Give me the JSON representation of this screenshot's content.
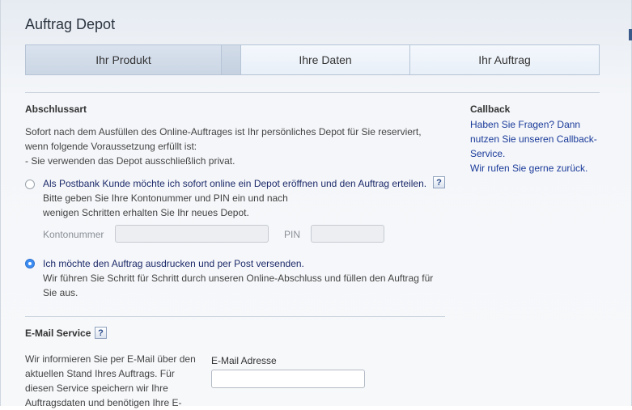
{
  "header": {
    "title": "Auftrag Depot"
  },
  "tabs": [
    {
      "label": "Ihr Produkt"
    },
    {
      "label": "Ihre Daten"
    },
    {
      "label": "Ihr Auftrag"
    }
  ],
  "abschluss": {
    "heading": "Abschlussart",
    "intro_line1": "Sofort nach dem Ausfüllen des Online-Auftrages ist Ihr persönliches Depot für Sie reserviert,",
    "intro_line2": "wenn folgende Voraussetzung erfüllt ist:",
    "intro_line3": "- Sie verwenden das Depot ausschließlich privat.",
    "option1": {
      "label": "Als Postbank Kunde möchte ich sofort online ein Depot eröffnen und den Auftrag erteilen.",
      "desc_line1": "Bitte geben Sie Ihre Kontonummer und PIN ein und nach",
      "desc_line2": "wenigen Schritten erhalten Sie Ihr neues Depot.",
      "account_label": "Kontonummer",
      "pin_label": "PIN",
      "checked": false
    },
    "option2": {
      "label": "Ich möchte den Auftrag ausdrucken und per Post versenden.",
      "desc_line1": "Wir führen Sie Schritt für Schritt durch unseren Online-Abschluss und füllen den Auftrag für",
      "desc_line2": "Sie aus.",
      "checked": true
    },
    "help_icon": "?"
  },
  "callback": {
    "heading": "Callback",
    "line1": "Haben Sie Fragen? Dann",
    "line2": "nutzen Sie unseren Callback-",
    "line3": "Service.",
    "line4": "Wir rufen Sie gerne zurück."
  },
  "email": {
    "heading": "E-Mail Service",
    "help_icon": "?",
    "desc_line1": "Wir informieren Sie per E-Mail über den",
    "desc_line2": "aktuellen Stand Ihres Auftrags. Für",
    "desc_line3": "diesen Service speichern wir Ihre",
    "desc_line4": "Auftragsdaten und benötigen Ihre E-",
    "field_label": "E-Mail Adresse",
    "value": ""
  }
}
